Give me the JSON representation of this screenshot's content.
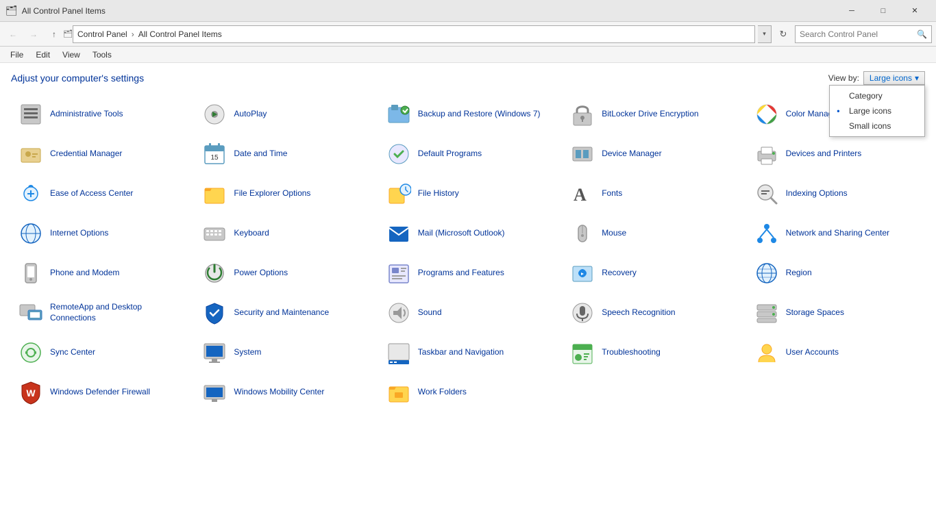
{
  "titleBar": {
    "icon": "🗂",
    "title": "All Control Panel Items",
    "buttons": {
      "minimize": "─",
      "restore": "□",
      "close": "✕"
    }
  },
  "addressBar": {
    "back": "←",
    "forward": "→",
    "up": "↑",
    "breadcrumb": [
      {
        "label": "Control Panel"
      },
      {
        "label": "All Control Panel Items"
      }
    ],
    "search_placeholder": "Search Control Panel",
    "refresh": "↻"
  },
  "menuBar": {
    "items": [
      "File",
      "Edit",
      "View",
      "Tools"
    ]
  },
  "pageTitle": "Adjust your computer's settings",
  "viewBy": {
    "label": "View by:",
    "current": "Large icons",
    "dropdown_arrow": "▾",
    "options": [
      {
        "label": "Category",
        "selected": false
      },
      {
        "label": "Large icons",
        "selected": true
      },
      {
        "label": "Small icons",
        "selected": false
      }
    ]
  },
  "items": [
    {
      "label": "Administrative Tools",
      "icon": "🔧",
      "emoji": "⚙"
    },
    {
      "label": "AutoPlay",
      "icon": "▶",
      "emoji": "▶"
    },
    {
      "label": "Backup and Restore (Windows 7)",
      "icon": "💾",
      "emoji": "💾"
    },
    {
      "label": "BitLocker Drive Encryption",
      "icon": "🔒",
      "emoji": "🔒"
    },
    {
      "label": "Color Management",
      "icon": "🎨",
      "emoji": "🎨"
    },
    {
      "label": "Credential Manager",
      "icon": "🔑",
      "emoji": "🔑"
    },
    {
      "label": "Date and Time",
      "icon": "🕐",
      "emoji": "🕐"
    },
    {
      "label": "Default Programs",
      "icon": "✔",
      "emoji": "✔"
    },
    {
      "label": "Device Manager",
      "icon": "🖥",
      "emoji": "🖥"
    },
    {
      "label": "Devices and Printers",
      "icon": "🖨",
      "emoji": "🖨"
    },
    {
      "label": "Ease of Access Center",
      "icon": "♿",
      "emoji": "♿"
    },
    {
      "label": "File Explorer Options",
      "icon": "📁",
      "emoji": "📁"
    },
    {
      "label": "File History",
      "icon": "📂",
      "emoji": "📂"
    },
    {
      "label": "Fonts",
      "icon": "A",
      "emoji": "A"
    },
    {
      "label": "Indexing Options",
      "icon": "🔍",
      "emoji": "🔍"
    },
    {
      "label": "Internet Options",
      "icon": "🌐",
      "emoji": "🌐"
    },
    {
      "label": "Keyboard",
      "icon": "⌨",
      "emoji": "⌨"
    },
    {
      "label": "Mail (Microsoft Outlook)",
      "icon": "📧",
      "emoji": "📧"
    },
    {
      "label": "Mouse",
      "icon": "🖱",
      "emoji": "🖱"
    },
    {
      "label": "Network and Sharing Center",
      "icon": "📡",
      "emoji": "📡"
    },
    {
      "label": "Phone and Modem",
      "icon": "📞",
      "emoji": "📞"
    },
    {
      "label": "Power Options",
      "icon": "⚡",
      "emoji": "⚡"
    },
    {
      "label": "Programs and Features",
      "icon": "📋",
      "emoji": "📋"
    },
    {
      "label": "Recovery",
      "icon": "🔄",
      "emoji": "🔄"
    },
    {
      "label": "Region",
      "icon": "🌍",
      "emoji": "🌍"
    },
    {
      "label": "RemoteApp and Desktop Connections",
      "icon": "🖥",
      "emoji": "🖥"
    },
    {
      "label": "Security and Maintenance",
      "icon": "🛡",
      "emoji": "🛡"
    },
    {
      "label": "Sound",
      "icon": "🔊",
      "emoji": "🔊"
    },
    {
      "label": "Speech Recognition",
      "icon": "🎤",
      "emoji": "🎤"
    },
    {
      "label": "Storage Spaces",
      "icon": "💽",
      "emoji": "💽"
    },
    {
      "label": "Sync Center",
      "icon": "🔃",
      "emoji": "🔃"
    },
    {
      "label": "System",
      "icon": "💻",
      "emoji": "💻"
    },
    {
      "label": "Taskbar and Navigation",
      "icon": "📌",
      "emoji": "📌"
    },
    {
      "label": "Troubleshooting",
      "icon": "🔧",
      "emoji": "🔧"
    },
    {
      "label": "User Accounts",
      "icon": "👤",
      "emoji": "👤"
    },
    {
      "label": "Windows Defender Firewall",
      "icon": "🛡",
      "emoji": "🛡"
    },
    {
      "label": "Windows Mobility Center",
      "icon": "💻",
      "emoji": "💻"
    },
    {
      "label": "Work Folders",
      "icon": "📁",
      "emoji": "📁"
    }
  ],
  "icons": {
    "search": "🔍",
    "chevron_down": "▾"
  }
}
